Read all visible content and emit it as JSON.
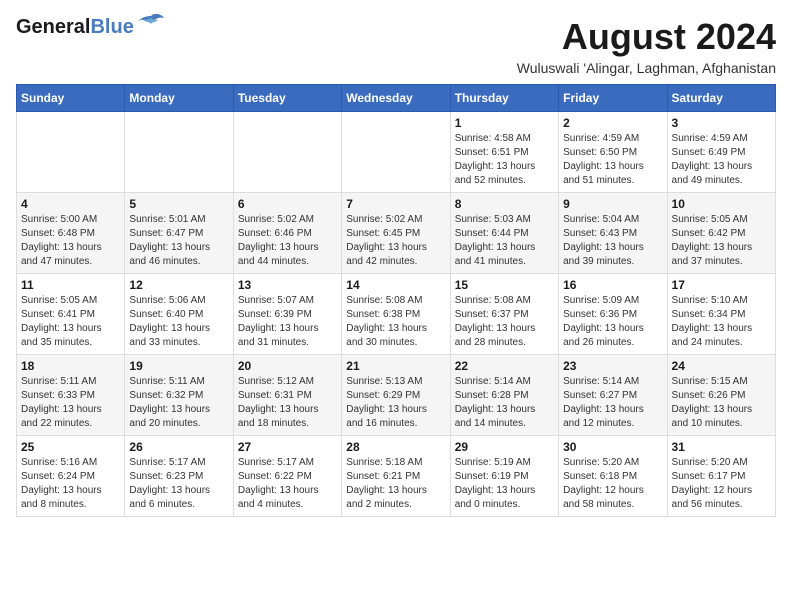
{
  "header": {
    "logo_line1": "General",
    "logo_line2": "Blue",
    "month_year": "August 2024",
    "location": "Wuluswali 'Alingar, Laghman, Afghanistan"
  },
  "weekdays": [
    "Sunday",
    "Monday",
    "Tuesday",
    "Wednesday",
    "Thursday",
    "Friday",
    "Saturday"
  ],
  "weeks": [
    [
      {
        "day": "",
        "info": ""
      },
      {
        "day": "",
        "info": ""
      },
      {
        "day": "",
        "info": ""
      },
      {
        "day": "",
        "info": ""
      },
      {
        "day": "1",
        "info": "Sunrise: 4:58 AM\nSunset: 6:51 PM\nDaylight: 13 hours\nand 52 minutes."
      },
      {
        "day": "2",
        "info": "Sunrise: 4:59 AM\nSunset: 6:50 PM\nDaylight: 13 hours\nand 51 minutes."
      },
      {
        "day": "3",
        "info": "Sunrise: 4:59 AM\nSunset: 6:49 PM\nDaylight: 13 hours\nand 49 minutes."
      }
    ],
    [
      {
        "day": "4",
        "info": "Sunrise: 5:00 AM\nSunset: 6:48 PM\nDaylight: 13 hours\nand 47 minutes."
      },
      {
        "day": "5",
        "info": "Sunrise: 5:01 AM\nSunset: 6:47 PM\nDaylight: 13 hours\nand 46 minutes."
      },
      {
        "day": "6",
        "info": "Sunrise: 5:02 AM\nSunset: 6:46 PM\nDaylight: 13 hours\nand 44 minutes."
      },
      {
        "day": "7",
        "info": "Sunrise: 5:02 AM\nSunset: 6:45 PM\nDaylight: 13 hours\nand 42 minutes."
      },
      {
        "day": "8",
        "info": "Sunrise: 5:03 AM\nSunset: 6:44 PM\nDaylight: 13 hours\nand 41 minutes."
      },
      {
        "day": "9",
        "info": "Sunrise: 5:04 AM\nSunset: 6:43 PM\nDaylight: 13 hours\nand 39 minutes."
      },
      {
        "day": "10",
        "info": "Sunrise: 5:05 AM\nSunset: 6:42 PM\nDaylight: 13 hours\nand 37 minutes."
      }
    ],
    [
      {
        "day": "11",
        "info": "Sunrise: 5:05 AM\nSunset: 6:41 PM\nDaylight: 13 hours\nand 35 minutes."
      },
      {
        "day": "12",
        "info": "Sunrise: 5:06 AM\nSunset: 6:40 PM\nDaylight: 13 hours\nand 33 minutes."
      },
      {
        "day": "13",
        "info": "Sunrise: 5:07 AM\nSunset: 6:39 PM\nDaylight: 13 hours\nand 31 minutes."
      },
      {
        "day": "14",
        "info": "Sunrise: 5:08 AM\nSunset: 6:38 PM\nDaylight: 13 hours\nand 30 minutes."
      },
      {
        "day": "15",
        "info": "Sunrise: 5:08 AM\nSunset: 6:37 PM\nDaylight: 13 hours\nand 28 minutes."
      },
      {
        "day": "16",
        "info": "Sunrise: 5:09 AM\nSunset: 6:36 PM\nDaylight: 13 hours\nand 26 minutes."
      },
      {
        "day": "17",
        "info": "Sunrise: 5:10 AM\nSunset: 6:34 PM\nDaylight: 13 hours\nand 24 minutes."
      }
    ],
    [
      {
        "day": "18",
        "info": "Sunrise: 5:11 AM\nSunset: 6:33 PM\nDaylight: 13 hours\nand 22 minutes."
      },
      {
        "day": "19",
        "info": "Sunrise: 5:11 AM\nSunset: 6:32 PM\nDaylight: 13 hours\nand 20 minutes."
      },
      {
        "day": "20",
        "info": "Sunrise: 5:12 AM\nSunset: 6:31 PM\nDaylight: 13 hours\nand 18 minutes."
      },
      {
        "day": "21",
        "info": "Sunrise: 5:13 AM\nSunset: 6:29 PM\nDaylight: 13 hours\nand 16 minutes."
      },
      {
        "day": "22",
        "info": "Sunrise: 5:14 AM\nSunset: 6:28 PM\nDaylight: 13 hours\nand 14 minutes."
      },
      {
        "day": "23",
        "info": "Sunrise: 5:14 AM\nSunset: 6:27 PM\nDaylight: 13 hours\nand 12 minutes."
      },
      {
        "day": "24",
        "info": "Sunrise: 5:15 AM\nSunset: 6:26 PM\nDaylight: 13 hours\nand 10 minutes."
      }
    ],
    [
      {
        "day": "25",
        "info": "Sunrise: 5:16 AM\nSunset: 6:24 PM\nDaylight: 13 hours\nand 8 minutes."
      },
      {
        "day": "26",
        "info": "Sunrise: 5:17 AM\nSunset: 6:23 PM\nDaylight: 13 hours\nand 6 minutes."
      },
      {
        "day": "27",
        "info": "Sunrise: 5:17 AM\nSunset: 6:22 PM\nDaylight: 13 hours\nand 4 minutes."
      },
      {
        "day": "28",
        "info": "Sunrise: 5:18 AM\nSunset: 6:21 PM\nDaylight: 13 hours\nand 2 minutes."
      },
      {
        "day": "29",
        "info": "Sunrise: 5:19 AM\nSunset: 6:19 PM\nDaylight: 13 hours\nand 0 minutes."
      },
      {
        "day": "30",
        "info": "Sunrise: 5:20 AM\nSunset: 6:18 PM\nDaylight: 12 hours\nand 58 minutes."
      },
      {
        "day": "31",
        "info": "Sunrise: 5:20 AM\nSunset: 6:17 PM\nDaylight: 12 hours\nand 56 minutes."
      }
    ]
  ]
}
